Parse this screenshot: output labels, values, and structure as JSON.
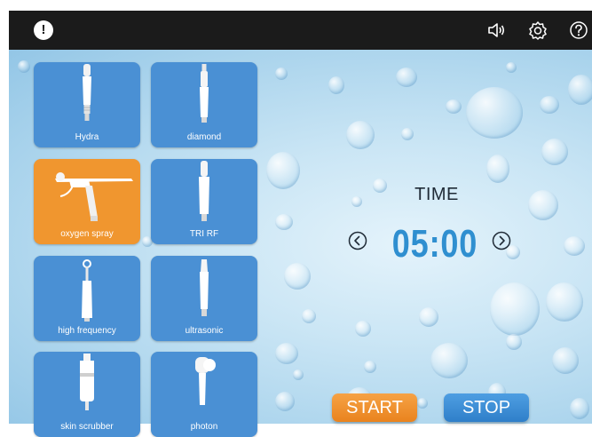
{
  "topbar": {
    "alert_glyph": "!",
    "icons": [
      "alert-icon",
      "speaker-icon",
      "settings-icon",
      "help-icon"
    ]
  },
  "tiles": [
    {
      "label": "Hydra",
      "icon": "hydra-handpiece-icon",
      "active": false
    },
    {
      "label": "diamond",
      "icon": "diamond-handpiece-icon",
      "active": false
    },
    {
      "label": "oxygen spray",
      "icon": "oxygen-spray-gun-icon",
      "active": true
    },
    {
      "label": "TRI RF",
      "icon": "tri-rf-handpiece-icon",
      "active": false
    },
    {
      "label": "high frequency",
      "icon": "high-frequency-wand-icon",
      "active": false
    },
    {
      "label": "ultrasonic",
      "icon": "ultrasonic-handpiece-icon",
      "active": false
    },
    {
      "label": "skin scrubber",
      "icon": "skin-scrubber-icon",
      "active": false
    },
    {
      "label": "photon",
      "icon": "photon-handpiece-icon",
      "active": false
    }
  ],
  "timer": {
    "label": "TIME",
    "value": "05:00"
  },
  "controls": {
    "start_label": "START",
    "stop_label": "STOP"
  },
  "colors": {
    "tile_blue": "#4a90d4",
    "tile_active_orange": "#f0962f",
    "timer_blue": "#2f8fd0",
    "topbar_bg": "#1b1b1b"
  }
}
